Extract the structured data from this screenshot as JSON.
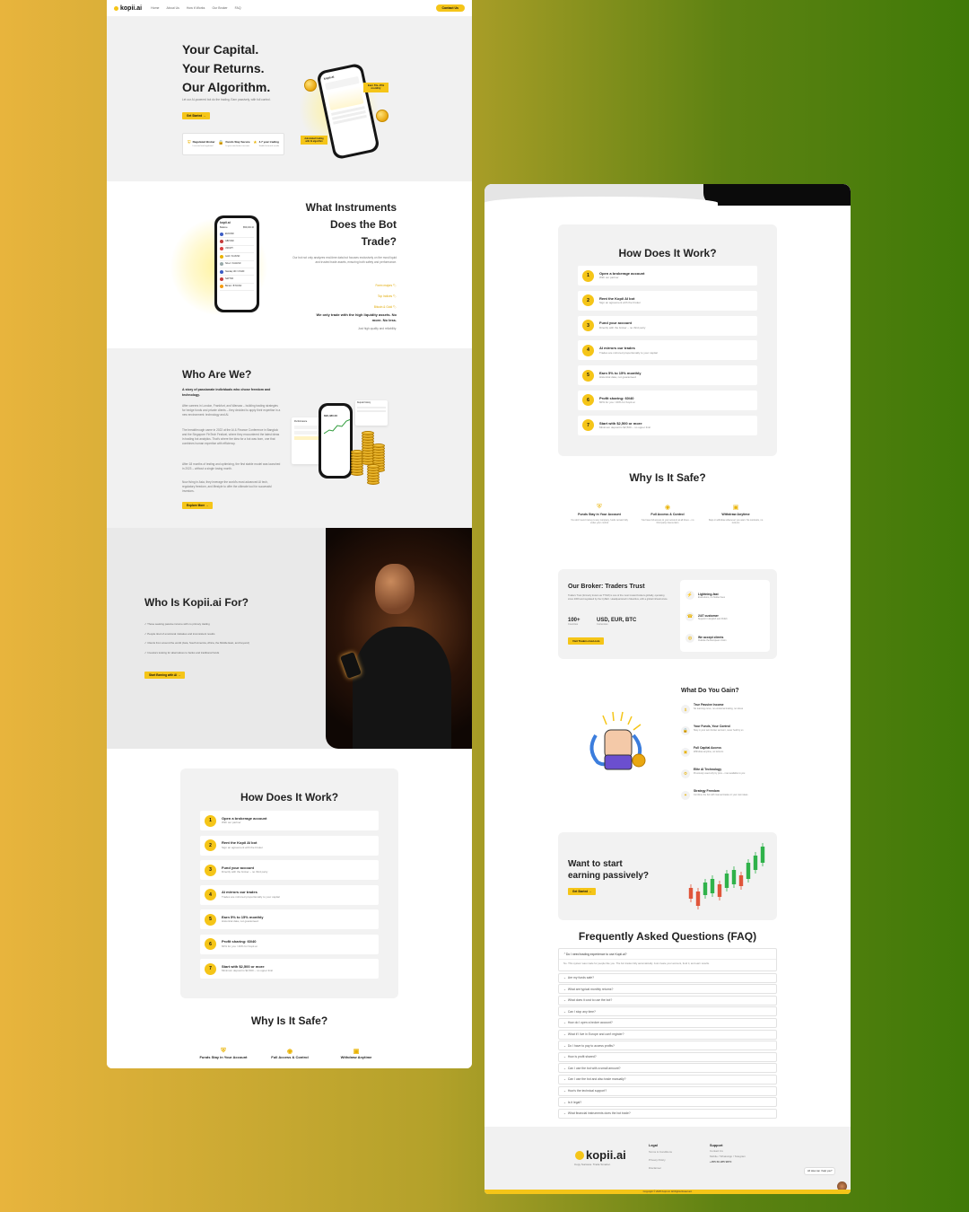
{
  "nav": {
    "logo": "kopii.ai",
    "links": [
      "Home",
      "About Us",
      "How it Works",
      "Our Broker",
      "FAQ"
    ],
    "cta": "Contact Us"
  },
  "hero": {
    "line1": "Your Capital.",
    "line2": "Your Returns.",
    "line3": "Our Algorithm.",
    "sub": "Let our AI-powered bot do the trading. Earn passively, with full control.",
    "cta": "Get Started",
    "badge1": "Earn 5%–15% monthly",
    "badge2": "Automated trading with AI algorithm",
    "features": [
      {
        "t": "Regulated Broker",
        "s": "Licensed and regulated"
      },
      {
        "t": "Funds Stay Secure",
        "s": "In your own broker account"
      },
      {
        "t": "4.7 year trading",
        "s": "Stable historical results"
      }
    ]
  },
  "instruments": {
    "title1": "What Instruments",
    "title2": "Does the Bot",
    "title3": "Trade?",
    "desc": "Our bot not only analyzes real-time data but focuses exclusively on the most liquid and trusted trade assets, ensuring both safety and performance.",
    "tags": [
      "Forex majors",
      "Top Indices",
      "Bitcoin & Gold"
    ],
    "bold": "We only trade with the high liquidity assets. No more. No less.",
    "foot": "Just high quality and reliability.",
    "phone_title": "kopii.ai",
    "phone_sub": "Balance",
    "phone_val": "$50,000.10",
    "assets": [
      "EURUSD",
      "GBPUSD",
      "USDJPY",
      "Gold / XAUUSD",
      "Silver / XAGUSD",
      "Nasdaq 100 / US100",
      "S&P 500",
      "Bitcoin / BTCUSD"
    ]
  },
  "who": {
    "title": "Who Are We?",
    "lead": "A story of passionate individuals who chose freedom and technology.",
    "p1": "After careers in London, Frankfurt, and Warsaw – building trading strategies for hedge funds and private clients – they decided to apply their expertise in a new environment: technology and AI.",
    "p2": "The breakthrough came in 2022 at the AI & Finance Conference in Bangkok and the Singapore FinTech Festival, where they encountered the latest ideas in trading bot analytics. That's where the idea for a bot was born, one that combines human expertise with efficiency.",
    "p3": "After 18 months of testing and optimizing, the first stable model was launched in 2023 – without a single losing month.",
    "p4": "Now living in Asia, they leverage the world's most advanced AI tech, regulatory freedom, and lifestyle to offer the ultimate tool for successful investors.",
    "cta": "Explore More",
    "phone_val": "$96,480.00",
    "chart_label": "Performance",
    "panel_title": "Deposit history"
  },
  "for": {
    "title": "Who Is Kopii.ai For?",
    "items": [
      "✓ Those seeking passive income with no primary trading",
      "✓ People tired of emotional mistakes and inconsistent results",
      "✓ Clients from around the world (Asia, South America, Africa, the Middle East, and beyond)",
      "✓ Investors looking for alternatives to banks and traditional funds"
    ],
    "cta": "Start Earning with AI"
  },
  "how": {
    "title": "How Does It Work?",
    "steps": [
      {
        "n": "1",
        "t": "Open a brokerage account",
        "s": "With our partner"
      },
      {
        "n": "2",
        "t": "Rent the Kopii AI bot",
        "s": "Sign an agreement with the broker"
      },
      {
        "n": "3",
        "t": "Fund your account",
        "s": "Directly with the broker – no third party"
      },
      {
        "n": "4",
        "t": "AI mirrors our trades",
        "s": "Trades are mirrored proportionally to your capital"
      },
      {
        "n": "5",
        "t": "Earn 5% to 15% monthly",
        "s": "Historical data, not guaranteed"
      },
      {
        "n": "6",
        "t": "Profit sharing: 60/40",
        "s": "60% for you / 40% for Kopii.ai"
      },
      {
        "n": "7",
        "t": "Start with $2,500 or more",
        "s": "Minimum deposit is $2,500 – no upper limit"
      }
    ]
  },
  "safe": {
    "title": "Why Is It Safe?",
    "items": [
      {
        "t": "Funds Stay in Your Account",
        "s": "You don't send money to any company, funds remain fully under your control"
      },
      {
        "t": "Full Access & Control",
        "s": "You have full access to your account at all times – no third party intervention"
      },
      {
        "t": "Withdraw Anytime",
        "s": "Stop or withdraw whenever you want. No contracts, no lock-ins"
      }
    ]
  },
  "broker": {
    "title": "Our Broker: Traders Trust",
    "desc": "Traders Trust (formerly known as TTCM) is one of the most trusted brokers globally, operating since 2009 and regulated by the CySEC. Headquartered in Mauritius, with a global infrastructure.",
    "stat1": "100+",
    "stat1l": "Countries",
    "stat2": "USD, EUR, BTC",
    "stat2l": "Currencies",
    "cta": "Visit Traders-trust.com",
    "feats": [
      {
        "t": "Lightning-fast",
        "s": "Executions, no hidden fees"
      },
      {
        "t": "24/7 customer",
        "s": "Support in English and Polish"
      },
      {
        "t": "We accept clients",
        "s": "Outside the European Union"
      }
    ]
  },
  "gain": {
    "title": "What Do You Gain?",
    "items": [
      {
        "t": "True Passive Income",
        "s": "No learning curve, no emotional trading, no stress"
      },
      {
        "t": "Your Funds, Your Control",
        "s": "Stay in your own broker account, never held by us"
      },
      {
        "t": "Full Capital Access",
        "s": "Withdraw anytime, no lock-ins"
      },
      {
        "t": "Elite AI Technology",
        "s": "Previously used only by pros – now available to you"
      },
      {
        "t": "Strategy Freedom",
        "s": "Combine the bot with manual trades or your own ideas"
      }
    ]
  },
  "start": {
    "line1": "Want to start",
    "line2": "earning passively?",
    "cta": "Get Started"
  },
  "faq": {
    "title": "Frequently Asked Questions (FAQ)",
    "open_q": "Do I need trading experience to use Kopii.ai?",
    "open_a": "No. This system was made for people like you. The bot trades fully automatically. Just create your account, fund it, and earn results.",
    "items": [
      "Are my funds safe?",
      "What are typical monthly returns?",
      "What does it cost to use the bot?",
      "Can I stop any time?",
      "How do I open a broker account?",
      "What if I live in Europe and can't register?",
      "Do I have to pay to access profits?",
      "How is profit shared?",
      "Can I use the bot with a small amount?",
      "Can I use the bot and also trade manually?",
      "How's the technical support?",
      "Is it legal?",
      "What financial instruments does the bot trade?"
    ]
  },
  "footer": {
    "logo": "kopii.ai",
    "tag": "Copy Success. Trade Smarter.",
    "legal_h": "Legal",
    "legal": [
      "Terms & Conditions",
      "Privacy Policy",
      "Disclaimer"
    ],
    "support_h": "Support",
    "support": [
      "Contact Us",
      "Mobile / WhatsApp / Telegram",
      "+355 69 285 9870"
    ],
    "copy": "Copyright © 2025 Kopii.AI. All Rights Reserved.",
    "chat": "Hi! How can I help you?"
  },
  "colors": {
    "accent": "#f5c518",
    "dark": "#111111",
    "grey": "#f1f1f1"
  }
}
